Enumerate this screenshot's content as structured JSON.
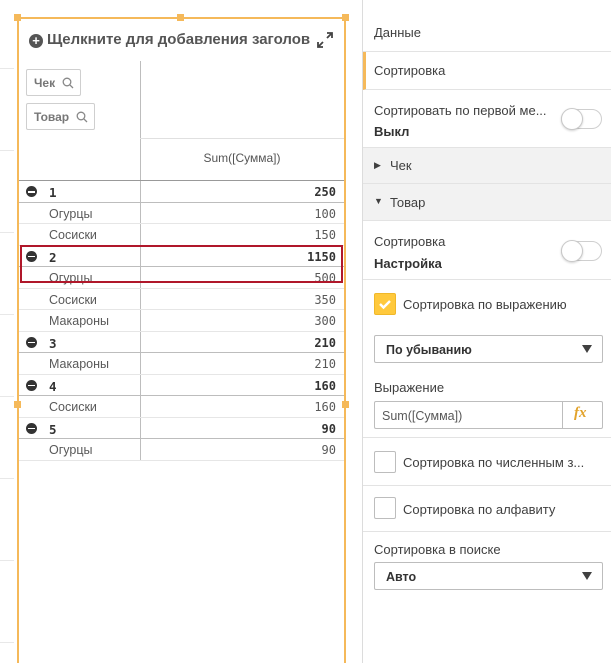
{
  "object": {
    "title": "Щелкните для добавления заголовка"
  },
  "pivot": {
    "dimensions": [
      "Чек",
      "Товар"
    ],
    "measure_header": "Sum([Сумма])",
    "rows": [
      {
        "type": "group",
        "label": "1",
        "value": "250"
      },
      {
        "type": "item",
        "label": "Огурцы",
        "value": "100"
      },
      {
        "type": "item",
        "label": "Сосиски",
        "value": "150"
      },
      {
        "type": "group",
        "label": "2",
        "value": "1150"
      },
      {
        "type": "item",
        "label": "Огурцы",
        "value": "500"
      },
      {
        "type": "item",
        "label": "Сосиски",
        "value": "350"
      },
      {
        "type": "item",
        "label": "Макароны",
        "value": "300"
      },
      {
        "type": "group",
        "label": "3",
        "value": "210"
      },
      {
        "type": "item",
        "label": "Макароны",
        "value": "210"
      },
      {
        "type": "group",
        "label": "4",
        "value": "160"
      },
      {
        "type": "item",
        "label": "Сосиски",
        "value": "160"
      },
      {
        "type": "group",
        "label": "5",
        "value": "90"
      },
      {
        "type": "item",
        "label": "Огурцы",
        "value": "90"
      }
    ],
    "highlight_color": "#b0172a"
  },
  "panel": {
    "data_label": "Данные",
    "sorting_label": "Сортировка",
    "sort_first": {
      "label": "Сортировать по первой ме...",
      "state": "Выкл"
    },
    "sections": [
      "Чек",
      "Товар"
    ],
    "item_sort": {
      "label": "Сортировка",
      "state": "Настройка"
    },
    "sort_by_expression": {
      "label": "Сортировка по выражению",
      "checked": true
    },
    "order_select": "По убыванию",
    "expression": {
      "label": "Выражение",
      "value": "Sum([Сумма])",
      "fx": "fx"
    },
    "sort_numeric": {
      "label": "Сортировка по численным з...",
      "checked": false
    },
    "sort_alpha": {
      "label": "Сортировка по алфавиту",
      "checked": false
    },
    "search_sort": {
      "label": "Сортировка в поиске",
      "value": "Авто"
    },
    "accent_color": "#f5b95a",
    "checkbox_color": "#ffc93c"
  }
}
